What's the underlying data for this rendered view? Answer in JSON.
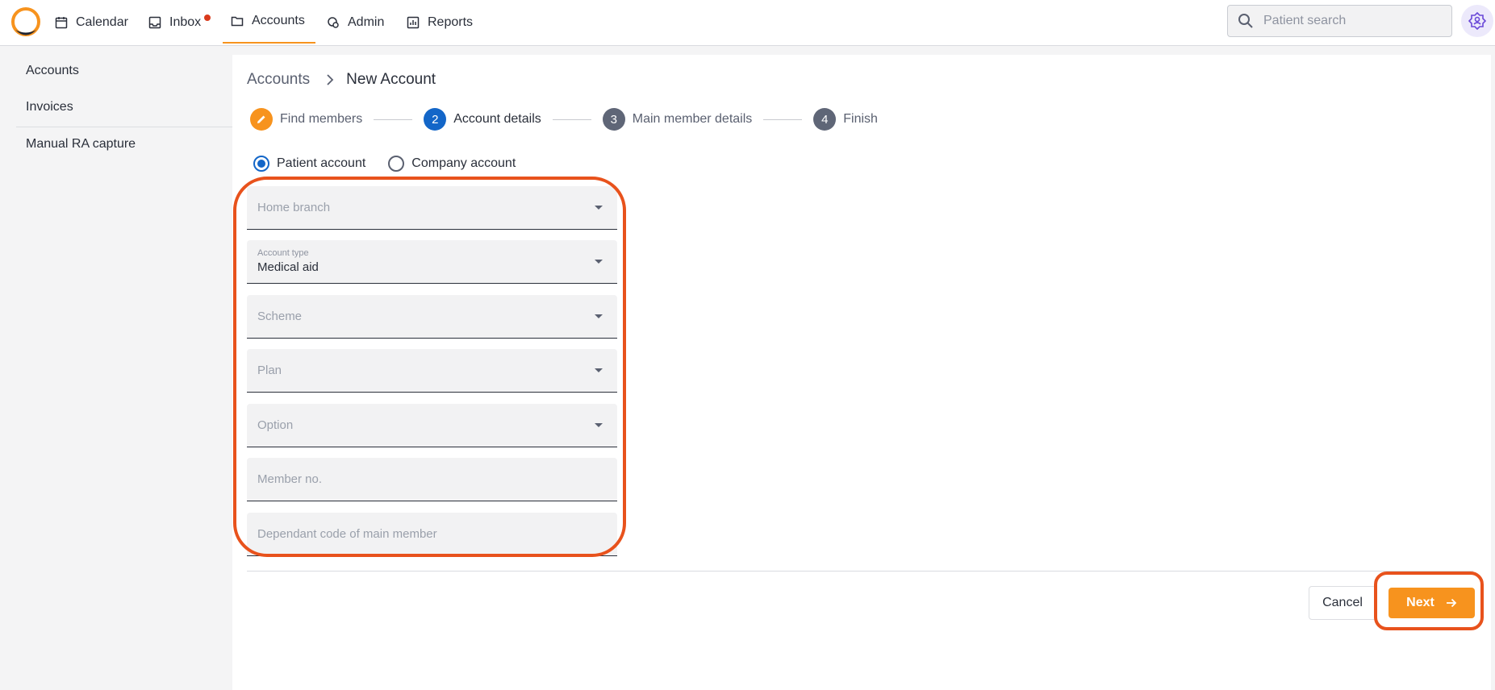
{
  "colors": {
    "accent": "#f7931e",
    "primary_blue": "#1366c8",
    "highlight": "#e8521c",
    "notification": "#d93a1c"
  },
  "nav": {
    "items": [
      {
        "label": "Calendar",
        "icon": "calendar-icon"
      },
      {
        "label": "Inbox",
        "icon": "inbox-icon"
      },
      {
        "label": "Accounts",
        "icon": "folder-icon",
        "active": true
      },
      {
        "label": "Admin",
        "icon": "admin-icon"
      },
      {
        "label": "Reports",
        "icon": "reports-icon"
      }
    ],
    "search_placeholder": "Patient search"
  },
  "sidebar": {
    "items": [
      {
        "label": "Accounts"
      },
      {
        "label": "Invoices"
      },
      {
        "label": "Manual RA capture"
      }
    ]
  },
  "breadcrumb": {
    "parent": "Accounts",
    "current": "New Account"
  },
  "stepper": {
    "steps": [
      {
        "number": "",
        "label": "Find members",
        "state": "edit"
      },
      {
        "number": "2",
        "label": "Account details",
        "state": "current"
      },
      {
        "number": "3",
        "label": "Main member details",
        "state": "pending"
      },
      {
        "number": "4",
        "label": "Finish",
        "state": "pending"
      }
    ]
  },
  "account_kind": {
    "options": [
      "Patient account",
      "Company account"
    ],
    "selected": "Patient account"
  },
  "form": {
    "home_branch": {
      "placeholder": "Home branch"
    },
    "account_type": {
      "label": "Account type",
      "value": "Medical aid"
    },
    "scheme": {
      "placeholder": "Scheme"
    },
    "plan": {
      "placeholder": "Plan"
    },
    "option": {
      "placeholder": "Option"
    },
    "member_no": {
      "placeholder": "Member no."
    },
    "dependant_code": {
      "placeholder": "Dependant code of main member"
    }
  },
  "actions": {
    "cancel_label": "Cancel",
    "next_label": "Next"
  }
}
